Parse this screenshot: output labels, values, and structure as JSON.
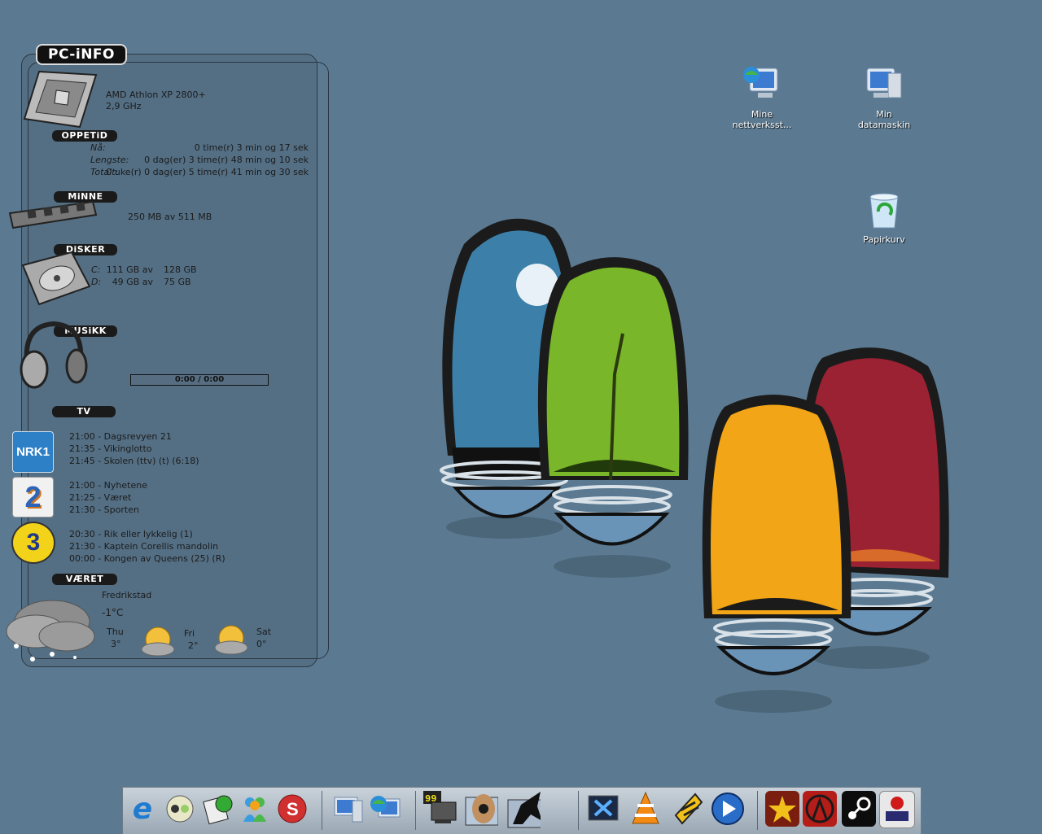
{
  "widget": {
    "title": "PC-iNFO",
    "cpu": {
      "name": "AMD Athlon XP 2800+",
      "speed": "2,9 GHz"
    },
    "uptime": {
      "header": "OPPETiD",
      "rows": [
        {
          "label": "Nå:",
          "value": "0 time(r) 3 min og 17 sek"
        },
        {
          "label": "Lengste:",
          "value": "0 dag(er) 3 time(r) 48 min og 10 sek"
        },
        {
          "label": "Totalt:",
          "value": "0 uke(r) 0 dag(er) 5 time(r) 41 min og 30 sek"
        }
      ]
    },
    "memory": {
      "header": "MiNNE",
      "value": "250 MB av 511 MB"
    },
    "disks": {
      "header": "DiSKER",
      "rows": [
        {
          "drive": "C:",
          "used": "111 GB av",
          "total": "128 GB"
        },
        {
          "drive": "D:",
          "used": "49 GB av",
          "total": "75 GB"
        }
      ]
    },
    "music": {
      "header": "MUSiKK",
      "time": "0:00 / 0:00"
    },
    "tv": {
      "header": "TV",
      "channels": [
        {
          "logo": "NRK1",
          "shows": [
            "21:00 - Dagsrevyen 21",
            "21:35 - Vikinglotto",
            "21:45 - Skolen (ttv) (t)  (6:18)"
          ]
        },
        {
          "logo": "2",
          "shows": [
            "21:00 - Nyhetene",
            "21:25 - Været",
            "21:30 - Sporten"
          ]
        },
        {
          "logo": "3",
          "shows": [
            "20:30 - Rik eller lykkelig (1)",
            "21:30 - Kaptein Corellis mandolin",
            "00:00 - Kongen av Queens (25) (R)"
          ]
        }
      ]
    },
    "weather": {
      "header": "VÆRET",
      "location": "Fredrikstad",
      "current": "-1°C",
      "forecast": [
        {
          "day": "Thu",
          "temp": "3°"
        },
        {
          "day": "Fri",
          "temp": "2°"
        },
        {
          "day": "Sat",
          "temp": "0°"
        }
      ]
    }
  },
  "desktop_icons": [
    {
      "label1": "Mine",
      "label2": "nettverksst...",
      "icon": "network-computer-icon"
    },
    {
      "label1": "Min",
      "label2": "datamaskin",
      "icon": "my-computer-icon"
    },
    {
      "label1": "Papirkurv",
      "label2": "",
      "icon": "recycle-bin-icon"
    }
  ],
  "dock": {
    "icons": [
      "internet-explorer-icon",
      "chat-icon",
      "ftp-icon",
      "messenger-icon",
      "skype-icon",
      "computer-icon",
      "network-icon",
      "monitor-99-icon",
      "eye-icon",
      "horse-icon",
      "media-x-icon",
      "vlc-icon",
      "winamp-icon",
      "media-player-icon",
      "star-game-icon",
      "half-life-icon",
      "steam-icon",
      "ea-game-icon"
    ],
    "badge_99": "99"
  },
  "colors": {
    "desktop": "#5b7a92",
    "widget": "#4e6678"
  }
}
